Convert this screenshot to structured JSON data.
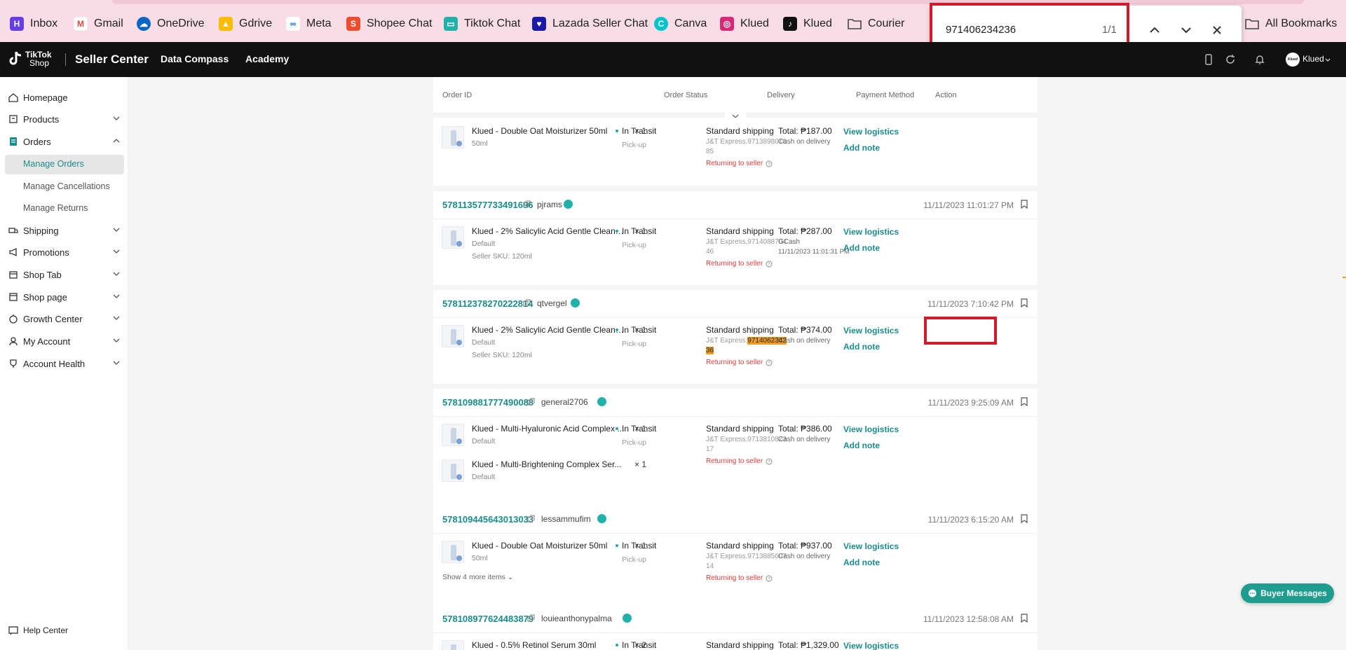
{
  "bookmarks": [
    {
      "label": "Inbox",
      "icon": "hostinger-icon"
    },
    {
      "label": "Gmail",
      "icon": "gmail-icon"
    },
    {
      "label": "OneDrive",
      "icon": "onedrive-icon"
    },
    {
      "label": "Gdrive",
      "icon": "gdrive-icon"
    },
    {
      "label": "Meta",
      "icon": "meta-icon"
    },
    {
      "label": "Shopee Chat",
      "icon": "shopee-icon"
    },
    {
      "label": "Tiktok Chat",
      "icon": "chat-icon"
    },
    {
      "label": "Lazada Seller Chat",
      "icon": "lazada-icon"
    },
    {
      "label": "Canva",
      "icon": "canva-icon"
    },
    {
      "label": "Klued",
      "icon": "instagram-icon"
    },
    {
      "label": "Klued",
      "icon": "tiktok-icon"
    },
    {
      "label": "Courier",
      "icon": "folder-icon"
    }
  ],
  "all_bookmarks": "All Bookmarks",
  "find": {
    "query": "971406234236",
    "count": "1/1"
  },
  "topnav": {
    "logo_line1": "TikTok",
    "logo_line2": "Shop",
    "title": "Seller Center",
    "links": [
      "Data Compass",
      "Academy"
    ],
    "account": "Klued",
    "avatar_text": "Klued"
  },
  "sidebar": {
    "items": [
      "Homepage",
      "Products",
      "Orders",
      "Shipping",
      "Promotions",
      "Shop Tab",
      "Shop page",
      "Growth Center",
      "My Account",
      "Account Health"
    ],
    "orders_sub": [
      "Manage Orders",
      "Manage Cancellations",
      "Manage Returns"
    ],
    "help": "Help Center"
  },
  "table_head": [
    "Order ID",
    "Order Status",
    "Delivery",
    "Payment Method",
    "Action"
  ],
  "common": {
    "status": "In Transit",
    "pickup": "Pick-up",
    "shipping": "Standard shipping",
    "returning": "Returning to seller",
    "view_logistics": "View logistics",
    "add_note": "Add note"
  },
  "orders": [
    {
      "id": "",
      "buyer": "",
      "time": "",
      "items": [
        {
          "name": "Klued - Double Oat Moisturizer 50ml",
          "variant": "50ml",
          "sku": "",
          "qty": "× 1"
        }
      ],
      "tracking1": "J&T Express,9713898010",
      "tracking2": "85",
      "total": "Total: ₱187.00",
      "payment": "Cash on delivery",
      "paydate": ""
    },
    {
      "id": "578113577733491696",
      "buyer": "pjrams",
      "time": "11/11/2023 11:01:27 PM",
      "items": [
        {
          "name": "Klued - 2% Salicylic Acid Gentle Cleans...",
          "variant": "Default",
          "sku": "Seller SKU: 120ml",
          "qty": "× 1"
        }
      ],
      "tracking1": "J&T Express,9714088704",
      "tracking2": "46",
      "total": "Total: ₱287.00",
      "payment": "GCash",
      "paydate": "11/11/2023 11:01:31 PM"
    },
    {
      "id": "578112378270222814",
      "buyer": "qtvergel",
      "time": "11/11/2023 7:10:42 PM",
      "items": [
        {
          "name": "Klued - 2% Salicylic Acid Gentle Cleans...",
          "variant": "Default",
          "sku": "Seller SKU: 120ml",
          "qty": "× 1"
        }
      ],
      "tracking_prefix": "J&T Express,",
      "tracking_hl1": "9714062342",
      "tracking_hl2": "36",
      "total": "Total: ₱374.00",
      "payment": "Cash on delivery",
      "paydate": ""
    },
    {
      "id": "578109881777490088",
      "buyer": "general2706",
      "time": "11/11/2023 9:25:09 AM",
      "items": [
        {
          "name": "Klued - Multi-Hyaluronic Acid Complex ...",
          "variant": "Default",
          "sku": "",
          "qty": "× 1"
        },
        {
          "name": "Klued - Multi-Brightening Complex Ser...",
          "variant": "Default",
          "sku": "",
          "qty": "× 1"
        }
      ],
      "tracking1": "J&T Express,9713810823",
      "tracking2": "17",
      "total": "Total: ₱386.00",
      "payment": "Cash on delivery",
      "paydate": ""
    },
    {
      "id": "578109445643013033",
      "buyer": "lessammufim",
      "time": "11/11/2023 6:15:20 AM",
      "items": [
        {
          "name": "Klued - Double Oat Moisturizer 50ml",
          "variant": "50ml",
          "sku": "",
          "qty": "× 1"
        }
      ],
      "show_more": "Show 4 more items",
      "tracking1": "J&T Express,9713885607",
      "tracking2": "14",
      "total": "Total: ₱937.00",
      "payment": "Cash on delivery",
      "paydate": ""
    },
    {
      "id": "578108977624483879",
      "buyer": "louieanthonypalma",
      "time": "11/11/2023 12:58:08 AM",
      "items": [
        {
          "name": "Klued - 0.5% Retinol Serum 30ml",
          "variant": "",
          "sku": "",
          "qty": "× 2"
        }
      ],
      "total": "Total: ₱1,329.00"
    }
  ],
  "buyer_messages": "Buyer Messages",
  "colors": {
    "accent": "#1a8c8c",
    "highlight_box": "#d11a2a",
    "find_highlight": "#f29d1e",
    "returning": "#e23b3b"
  }
}
